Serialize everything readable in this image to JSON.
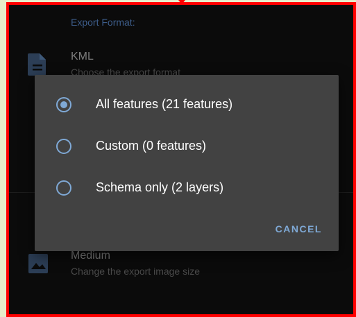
{
  "settings": {
    "section_header": "Export Format:",
    "rows": [
      {
        "title": "KML",
        "summary": "Choose the export format",
        "icon": "file-document-icon"
      },
      {
        "title": "Medium",
        "summary": "Change the export image size",
        "icon": "image-icon"
      }
    ]
  },
  "dialog": {
    "options": [
      {
        "label": "All features (21 features)",
        "selected": true
      },
      {
        "label": "Custom (0 features)",
        "selected": false
      },
      {
        "label": "Schema only (2 layers)",
        "selected": false
      }
    ],
    "cancel_label": "CANCEL"
  },
  "colors": {
    "accent": "#7fa9d6",
    "dialog_bg": "#424242",
    "frame_border": "#ff0000"
  }
}
